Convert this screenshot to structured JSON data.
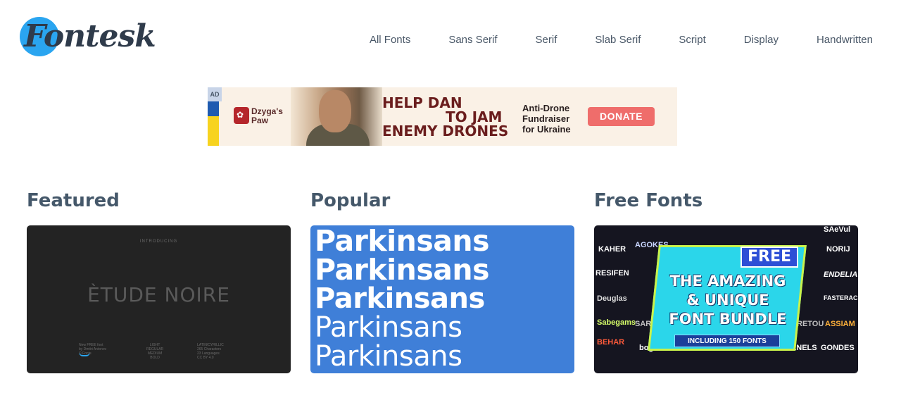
{
  "header": {
    "logo_text": "Fontesk",
    "nav": [
      "All Fonts",
      "Sans Serif",
      "Serif",
      "Slab Serif",
      "Script",
      "Display",
      "Handwritten"
    ]
  },
  "ad": {
    "tag": "AD",
    "brand": "Dzyga's Paw",
    "headline": [
      "HELP DAN",
      "TO JAM",
      "ENEMY DRONES"
    ],
    "subtext": [
      "Anti-Drone",
      "Fundraiser",
      "for Ukraine"
    ],
    "button": "DONATE"
  },
  "sections": {
    "featured": {
      "title": "Featured",
      "intro": "INTRODUCING",
      "font_name": "ÈTUDE NOIRE",
      "col1": [
        "New FREE font",
        "by Dmitri Antonov",
        "© Fonts"
      ],
      "col2": [
        "LIGHT",
        "REGULAR",
        "MEDIUM",
        "BOLD"
      ],
      "col3": [
        "LATIN/CYRILLIC",
        "265 Characters",
        "23 Languages",
        "CC BY 4.0"
      ]
    },
    "popular": {
      "title": "Popular",
      "samples": [
        "Parkinsans",
        "Parkinsans",
        "Parkinsans",
        "Parkinsans",
        "Parkinsans"
      ]
    },
    "free": {
      "title": "Free Fonts",
      "badge": "FREE",
      "headline": [
        "THE AMAZING",
        "& UNIQUE",
        "FONT BUNDLE"
      ],
      "including": "INCLUDING 150 FONTS",
      "tiles": [
        "KAHER",
        "AGOKES",
        "Deuglas",
        "Sabegams",
        "BEHAR",
        "bogiar",
        "RESIFEN",
        "NORIJ",
        "ENDELIA",
        "FASTERACE",
        "ASSIAM",
        "GONDES",
        "AXNELS",
        "SAeVul",
        "SARI",
        "RETOU"
      ]
    }
  }
}
